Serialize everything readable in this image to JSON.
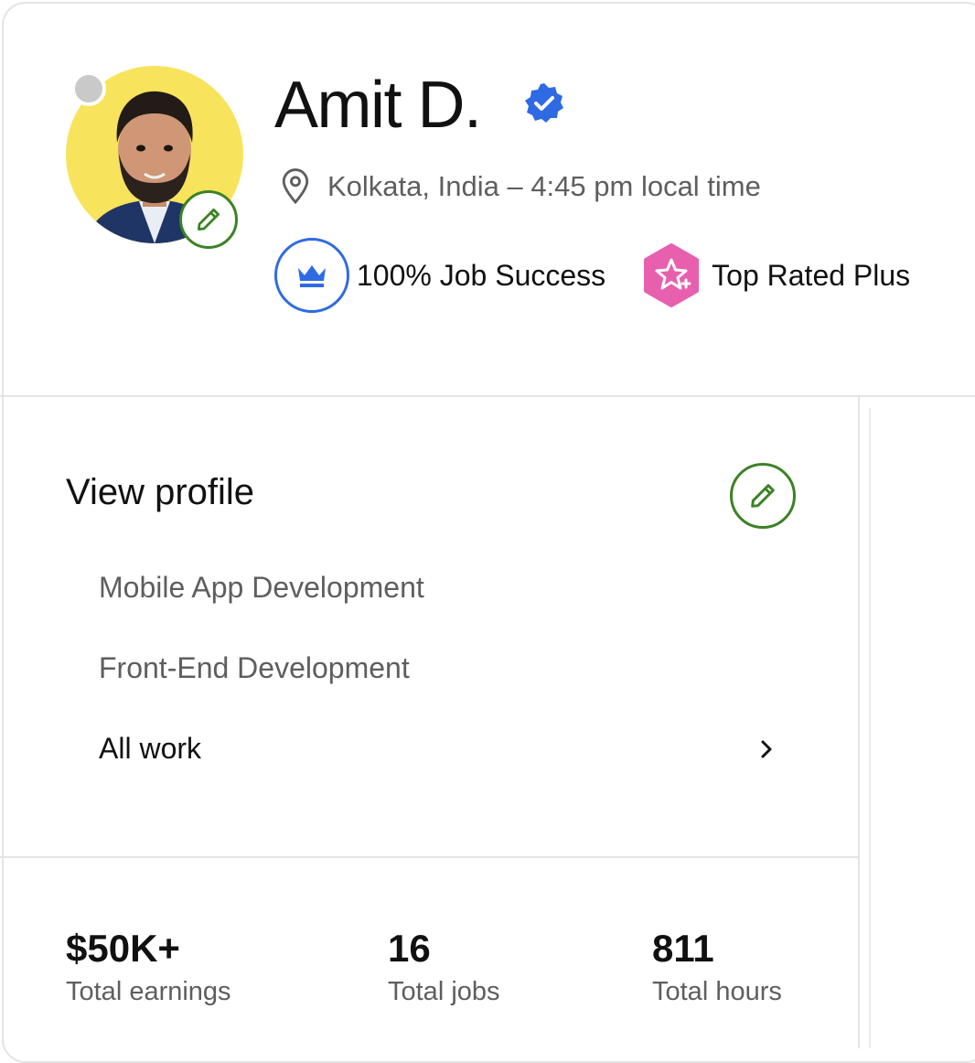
{
  "profile": {
    "name": "Amit D.",
    "location": "Kolkata, India – 4:45 pm local time",
    "job_success": "100% Job Success",
    "top_rated": "Top Rated Plus"
  },
  "sections": {
    "view_profile": "View profile",
    "specialties": [
      "Mobile App Development",
      "Front-End Development"
    ],
    "all_work": "All work"
  },
  "stats": [
    {
      "value": "$50K+",
      "label": "Total earnings"
    },
    {
      "value": "16",
      "label": "Total jobs"
    },
    {
      "value": "811",
      "label": "Total hours"
    }
  ],
  "colors": {
    "edit_green": "#3c8224",
    "verified_blue": "#2e6ae3",
    "top_rated_pink": "#e85fae",
    "avatar_bg": "#f8e35c"
  },
  "icons": {
    "location": "map-pin-icon",
    "edit": "pencil-icon",
    "verified": "verified-badge-icon",
    "job_success": "crown-icon",
    "top_rated": "star-hexagon-icon",
    "chevron": "chevron-right-icon"
  }
}
